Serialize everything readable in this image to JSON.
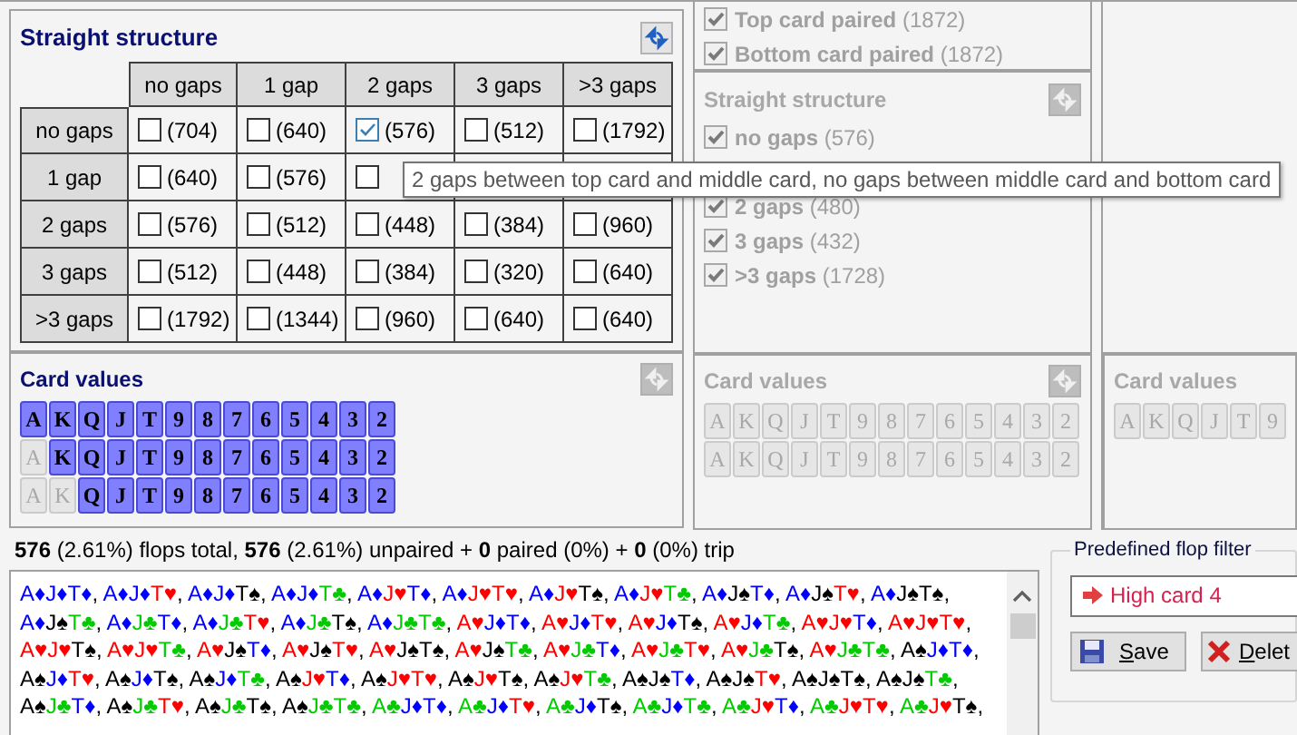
{
  "left_panel": {
    "straight_structure": {
      "title": "Straight structure",
      "columns": [
        "no gaps",
        "1 gap",
        "2 gaps",
        "3 gaps",
        ">3 gaps"
      ],
      "rows": [
        {
          "label": "no gaps",
          "cells": [
            {
              "count": "(704)",
              "checked": false
            },
            {
              "count": "(640)",
              "checked": false
            },
            {
              "count": "(576)",
              "checked": true
            },
            {
              "count": "(512)",
              "checked": false
            },
            {
              "count": "(1792)",
              "checked": false
            }
          ]
        },
        {
          "label": "1 gap",
          "cells": [
            {
              "count": "(640)",
              "checked": false
            },
            {
              "count": "(576)",
              "checked": false
            },
            {
              "checked": false
            },
            null,
            null
          ]
        },
        {
          "label": "2 gaps",
          "cells": [
            {
              "count": "(576)",
              "checked": false
            },
            {
              "count": "(512)",
              "checked": false
            },
            {
              "count": "(448)",
              "checked": false
            },
            {
              "count": "(384)",
              "checked": false
            },
            {
              "count": "(960)",
              "checked": false
            }
          ]
        },
        {
          "label": "3 gaps",
          "cells": [
            {
              "count": "(512)",
              "checked": false
            },
            {
              "count": "(448)",
              "checked": false
            },
            {
              "count": "(384)",
              "checked": false
            },
            {
              "count": "(320)",
              "checked": false
            },
            {
              "count": "(640)",
              "checked": false
            }
          ]
        },
        {
          "label": ">3 gaps",
          "cells": [
            {
              "count": "(1792)",
              "checked": false
            },
            {
              "count": "(1344)",
              "checked": false
            },
            {
              "count": "(960)",
              "checked": false
            },
            {
              "count": "(640)",
              "checked": false
            },
            {
              "count": "(640)",
              "checked": false
            }
          ]
        }
      ]
    },
    "card_values": {
      "title": "Card values",
      "rows": [
        {
          "cards": [
            {
              "rank": "A",
              "selected": true
            },
            {
              "rank": "K",
              "selected": true
            },
            {
              "rank": "Q",
              "selected": true
            },
            {
              "rank": "J",
              "selected": true
            },
            {
              "rank": "T",
              "selected": true
            },
            {
              "rank": "9",
              "selected": true
            },
            {
              "rank": "8",
              "selected": true
            },
            {
              "rank": "7",
              "selected": true
            },
            {
              "rank": "6",
              "selected": true
            },
            {
              "rank": "5",
              "selected": true
            },
            {
              "rank": "4",
              "selected": true
            },
            {
              "rank": "3",
              "selected": true
            },
            {
              "rank": "2",
              "selected": true
            }
          ]
        },
        {
          "cards": [
            {
              "rank": "A",
              "selected": false
            },
            {
              "rank": "K",
              "selected": true
            },
            {
              "rank": "Q",
              "selected": true
            },
            {
              "rank": "J",
              "selected": true
            },
            {
              "rank": "T",
              "selected": true
            },
            {
              "rank": "9",
              "selected": true
            },
            {
              "rank": "8",
              "selected": true
            },
            {
              "rank": "7",
              "selected": true
            },
            {
              "rank": "6",
              "selected": true
            },
            {
              "rank": "5",
              "selected": true
            },
            {
              "rank": "4",
              "selected": true
            },
            {
              "rank": "3",
              "selected": true
            },
            {
              "rank": "2",
              "selected": true
            }
          ]
        },
        {
          "cards": [
            {
              "rank": "A",
              "selected": false
            },
            {
              "rank": "K",
              "selected": false
            },
            {
              "rank": "Q",
              "selected": true
            },
            {
              "rank": "J",
              "selected": true
            },
            {
              "rank": "T",
              "selected": true
            },
            {
              "rank": "9",
              "selected": true
            },
            {
              "rank": "8",
              "selected": true
            },
            {
              "rank": "7",
              "selected": true
            },
            {
              "rank": "6",
              "selected": true
            },
            {
              "rank": "5",
              "selected": true
            },
            {
              "rank": "4",
              "selected": true
            },
            {
              "rank": "3",
              "selected": true
            },
            {
              "rank": "2",
              "selected": true
            }
          ]
        }
      ]
    }
  },
  "middle_panel": {
    "disabled": true,
    "paired": [
      {
        "label": "Top card paired",
        "count": "(1872)",
        "checked": true
      },
      {
        "label": "Bottom card paired",
        "count": "(1872)",
        "checked": true
      }
    ],
    "straight_structure": {
      "title": "Straight structure",
      "items": [
        {
          "kind": "checkbox",
          "label": "no gaps",
          "count": "(576)",
          "checked": true
        },
        {
          "kind": "covered"
        },
        {
          "kind": "checkbox",
          "label": "2 gaps",
          "count": "(480)",
          "checked": true
        },
        {
          "kind": "checkbox",
          "label": "3 gaps",
          "count": "(432)",
          "checked": true
        },
        {
          "kind": "checkbox",
          "label": ">3 gaps",
          "count": "(1728)",
          "checked": true
        }
      ]
    },
    "card_values": {
      "title": "Card values",
      "rows": [
        {
          "cards": [
            {
              "rank": "A",
              "selected": false
            },
            {
              "rank": "K",
              "selected": false
            },
            {
              "rank": "Q",
              "selected": false
            },
            {
              "rank": "J",
              "selected": false
            },
            {
              "rank": "T",
              "selected": false
            },
            {
              "rank": "9",
              "selected": false
            },
            {
              "rank": "8",
              "selected": false
            },
            {
              "rank": "7",
              "selected": false
            },
            {
              "rank": "6",
              "selected": false
            },
            {
              "rank": "5",
              "selected": false
            },
            {
              "rank": "4",
              "selected": false
            },
            {
              "rank": "3",
              "selected": false
            },
            {
              "rank": "2",
              "selected": false
            }
          ]
        },
        {
          "cards": [
            {
              "rank": "A",
              "selected": false
            },
            {
              "rank": "K",
              "selected": false
            },
            {
              "rank": "Q",
              "selected": false
            },
            {
              "rank": "J",
              "selected": false
            },
            {
              "rank": "T",
              "selected": false
            },
            {
              "rank": "9",
              "selected": false
            },
            {
              "rank": "8",
              "selected": false
            },
            {
              "rank": "7",
              "selected": false
            },
            {
              "rank": "6",
              "selected": false
            },
            {
              "rank": "5",
              "selected": false
            },
            {
              "rank": "4",
              "selected": false
            },
            {
              "rank": "3",
              "selected": false
            },
            {
              "rank": "2",
              "selected": false
            }
          ]
        }
      ]
    }
  },
  "right_panel": {
    "card_values": {
      "title": "Card values",
      "rows": [
        {
          "cards": [
            {
              "rank": "A",
              "selected": false
            },
            {
              "rank": "K",
              "selected": false
            },
            {
              "rank": "Q",
              "selected": false
            },
            {
              "rank": "J",
              "selected": false
            },
            {
              "rank": "T",
              "selected": false
            },
            {
              "rank": "9",
              "selected": false
            }
          ]
        }
      ]
    }
  },
  "tooltip": "2 gaps between top card and middle card, no gaps between middle card and bottom card",
  "summary": "**576** (2.61%) flops total, **576** (2.61%) unpaired + **0** paired (0%) + **0** (0%) trip",
  "flops": [
    {
      "cards": [
        {
          "text": "A♦",
          "color": "#0000ff"
        },
        {
          "text": "J♦",
          "color": "#0000ff"
        },
        {
          "text": "T♦",
          "color": "#0000ff"
        }
      ],
      "suffix": ","
    },
    {
      "cards": [
        {
          "text": "A♦",
          "color": "#0000ff"
        },
        {
          "text": "J♦",
          "color": "#0000ff"
        },
        {
          "text": "T♥",
          "color": "#ff0000"
        }
      ],
      "suffix": ","
    },
    {
      "cards": [
        {
          "text": "A♦",
          "color": "#0000ff"
        },
        {
          "text": "J♦",
          "color": "#0000ff"
        },
        {
          "text": "T♠",
          "color": "#000000"
        }
      ],
      "suffix": ","
    },
    {
      "cards": [
        {
          "text": "A♦",
          "color": "#0000ff"
        },
        {
          "text": "J♦",
          "color": "#0000ff"
        },
        {
          "text": "T♣",
          "color": "#00cc00"
        }
      ],
      "suffix": ","
    },
    {
      "cards": [
        {
          "text": "A♦",
          "color": "#0000ff"
        },
        {
          "text": "J♥",
          "color": "#ff0000"
        },
        {
          "text": "T♦",
          "color": "#0000ff"
        }
      ],
      "suffix": ","
    },
    {
      "cards": [
        {
          "text": "A♦",
          "color": "#0000ff"
        },
        {
          "text": "J♥",
          "color": "#ff0000"
        },
        {
          "text": "T♥",
          "color": "#ff0000"
        }
      ],
      "suffix": ","
    },
    {
      "cards": [
        {
          "text": "A♦",
          "color": "#0000ff"
        },
        {
          "text": "J♥",
          "color": "#ff0000"
        },
        {
          "text": "T♠",
          "color": "#000000"
        }
      ],
      "suffix": ","
    },
    {
      "cards": [
        {
          "text": "A♦",
          "color": "#0000ff"
        },
        {
          "text": "J♥",
          "color": "#ff0000"
        },
        {
          "text": "T♣",
          "color": "#00cc00"
        }
      ],
      "suffix": ","
    },
    {
      "cards": [
        {
          "text": "A♦",
          "color": "#0000ff"
        },
        {
          "text": "J♠",
          "color": "#000000"
        },
        {
          "text": "T♦",
          "color": "#0000ff"
        }
      ],
      "suffix": ","
    },
    {
      "cards": [
        {
          "text": "A♦",
          "color": "#0000ff"
        },
        {
          "text": "J♠",
          "color": "#000000"
        },
        {
          "text": "T♥",
          "color": "#ff0000"
        }
      ],
      "suffix": ","
    },
    {
      "cards": [
        {
          "text": "A♦",
          "color": "#0000ff"
        },
        {
          "text": "J♠",
          "color": "#000000"
        },
        {
          "text": "T♠",
          "color": "#000000"
        }
      ],
      "suffix": ","
    },
    {
      "cards": [
        {
          "text": "A♦",
          "color": "#0000ff"
        },
        {
          "text": "J♠",
          "color": "#000000"
        },
        {
          "text": "T♣",
          "color": "#00cc00"
        }
      ],
      "suffix": ","
    },
    {
      "cards": [
        {
          "text": "A♦",
          "color": "#0000ff"
        },
        {
          "text": "J♣",
          "color": "#00cc00"
        },
        {
          "text": "T♦",
          "color": "#0000ff"
        }
      ],
      "suffix": ","
    },
    {
      "cards": [
        {
          "text": "A♦",
          "color": "#0000ff"
        },
        {
          "text": "J♣",
          "color": "#00cc00"
        },
        {
          "text": "T♥",
          "color": "#ff0000"
        }
      ],
      "suffix": ","
    },
    {
      "cards": [
        {
          "text": "A♦",
          "color": "#0000ff"
        },
        {
          "text": "J♣",
          "color": "#00cc00"
        },
        {
          "text": "T♠",
          "color": "#000000"
        }
      ],
      "suffix": ","
    },
    {
      "cards": [
        {
          "text": "A♦",
          "color": "#0000ff"
        },
        {
          "text": "J♣",
          "color": "#00cc00"
        },
        {
          "text": "T♣",
          "color": "#00cc00"
        }
      ],
      "suffix": ","
    },
    {
      "cards": [
        {
          "text": "A♥",
          "color": "#ff0000"
        },
        {
          "text": "J♦",
          "color": "#0000ff"
        },
        {
          "text": "T♦",
          "color": "#0000ff"
        }
      ],
      "suffix": ","
    },
    {
      "cards": [
        {
          "text": "A♥",
          "color": "#ff0000"
        },
        {
          "text": "J♦",
          "color": "#0000ff"
        },
        {
          "text": "T♥",
          "color": "#ff0000"
        }
      ],
      "suffix": ","
    },
    {
      "cards": [
        {
          "text": "A♥",
          "color": "#ff0000"
        },
        {
          "text": "J♦",
          "color": "#0000ff"
        },
        {
          "text": "T♠",
          "color": "#000000"
        }
      ],
      "suffix": ","
    },
    {
      "cards": [
        {
          "text": "A♥",
          "color": "#ff0000"
        },
        {
          "text": "J♦",
          "color": "#0000ff"
        },
        {
          "text": "T♣",
          "color": "#00cc00"
        }
      ],
      "suffix": ","
    },
    {
      "cards": [
        {
          "text": "A♥",
          "color": "#ff0000"
        },
        {
          "text": "J♥",
          "color": "#ff0000"
        },
        {
          "text": "T♦",
          "color": "#0000ff"
        }
      ],
      "suffix": ","
    },
    {
      "cards": [
        {
          "text": "A♥",
          "color": "#ff0000"
        },
        {
          "text": "J♥",
          "color": "#ff0000"
        },
        {
          "text": "T♥",
          "color": "#ff0000"
        }
      ],
      "suffix": ","
    },
    {
      "cards": [
        {
          "text": "A♥",
          "color": "#ff0000"
        },
        {
          "text": "J♥",
          "color": "#ff0000"
        },
        {
          "text": "T♠",
          "color": "#000000"
        }
      ],
      "suffix": ","
    },
    {
      "cards": [
        {
          "text": "A♥",
          "color": "#ff0000"
        },
        {
          "text": "J♥",
          "color": "#ff0000"
        },
        {
          "text": "T♣",
          "color": "#00cc00"
        }
      ],
      "suffix": ","
    },
    {
      "cards": [
        {
          "text": "A♥",
          "color": "#ff0000"
        },
        {
          "text": "J♠",
          "color": "#000000"
        },
        {
          "text": "T♦",
          "color": "#0000ff"
        }
      ],
      "suffix": ","
    },
    {
      "cards": [
        {
          "text": "A♥",
          "color": "#ff0000"
        },
        {
          "text": "J♠",
          "color": "#000000"
        },
        {
          "text": "T♥",
          "color": "#ff0000"
        }
      ],
      "suffix": ","
    },
    {
      "cards": [
        {
          "text": "A♥",
          "color": "#ff0000"
        },
        {
          "text": "J♠",
          "color": "#000000"
        },
        {
          "text": "T♠",
          "color": "#000000"
        }
      ],
      "suffix": ","
    },
    {
      "cards": [
        {
          "text": "A♥",
          "color": "#ff0000"
        },
        {
          "text": "J♠",
          "color": "#000000"
        },
        {
          "text": "T♣",
          "color": "#00cc00"
        }
      ],
      "suffix": ","
    },
    {
      "cards": [
        {
          "text": "A♥",
          "color": "#ff0000"
        },
        {
          "text": "J♣",
          "color": "#00cc00"
        },
        {
          "text": "T♦",
          "color": "#0000ff"
        }
      ],
      "suffix": ","
    },
    {
      "cards": [
        {
          "text": "A♥",
          "color": "#ff0000"
        },
        {
          "text": "J♣",
          "color": "#00cc00"
        },
        {
          "text": "T♥",
          "color": "#ff0000"
        }
      ],
      "suffix": ","
    },
    {
      "cards": [
        {
          "text": "A♥",
          "color": "#ff0000"
        },
        {
          "text": "J♣",
          "color": "#00cc00"
        },
        {
          "text": "T♠",
          "color": "#000000"
        }
      ],
      "suffix": ","
    },
    {
      "cards": [
        {
          "text": "A♥",
          "color": "#ff0000"
        },
        {
          "text": "J♣",
          "color": "#00cc00"
        },
        {
          "text": "T♣",
          "color": "#00cc00"
        }
      ],
      "suffix": ","
    },
    {
      "cards": [
        {
          "text": "A♠",
          "color": "#000000"
        },
        {
          "text": "J♦",
          "color": "#0000ff"
        },
        {
          "text": "T♦",
          "color": "#0000ff"
        }
      ],
      "suffix": ","
    },
    {
      "cards": [
        {
          "text": "A♠",
          "color": "#000000"
        },
        {
          "text": "J♦",
          "color": "#0000ff"
        },
        {
          "text": "T♥",
          "color": "#ff0000"
        }
      ],
      "suffix": ","
    },
    {
      "cards": [
        {
          "text": "A♠",
          "color": "#000000"
        },
        {
          "text": "J♦",
          "color": "#0000ff"
        },
        {
          "text": "T♠",
          "color": "#000000"
        }
      ],
      "suffix": ","
    },
    {
      "cards": [
        {
          "text": "A♠",
          "color": "#000000"
        },
        {
          "text": "J♦",
          "color": "#0000ff"
        },
        {
          "text": "T♣",
          "color": "#00cc00"
        }
      ],
      "suffix": ","
    },
    {
      "cards": [
        {
          "text": "A♠",
          "color": "#000000"
        },
        {
          "text": "J♥",
          "color": "#ff0000"
        },
        {
          "text": "T♦",
          "color": "#0000ff"
        }
      ],
      "suffix": ","
    },
    {
      "cards": [
        {
          "text": "A♠",
          "color": "#000000"
        },
        {
          "text": "J♥",
          "color": "#ff0000"
        },
        {
          "text": "T♥",
          "color": "#ff0000"
        }
      ],
      "suffix": ","
    },
    {
      "cards": [
        {
          "text": "A♠",
          "color": "#000000"
        },
        {
          "text": "J♥",
          "color": "#ff0000"
        },
        {
          "text": "T♠",
          "color": "#000000"
        }
      ],
      "suffix": ","
    },
    {
      "cards": [
        {
          "text": "A♠",
          "color": "#000000"
        },
        {
          "text": "J♥",
          "color": "#ff0000"
        },
        {
          "text": "T♣",
          "color": "#00cc00"
        }
      ],
      "suffix": ","
    },
    {
      "cards": [
        {
          "text": "A♠",
          "color": "#000000"
        },
        {
          "text": "J♠",
          "color": "#000000"
        },
        {
          "text": "T♦",
          "color": "#0000ff"
        }
      ],
      "suffix": ","
    },
    {
      "cards": [
        {
          "text": "A♠",
          "color": "#000000"
        },
        {
          "text": "J♠",
          "color": "#000000"
        },
        {
          "text": "T♥",
          "color": "#ff0000"
        }
      ],
      "suffix": ","
    },
    {
      "cards": [
        {
          "text": "A♠",
          "color": "#000000"
        },
        {
          "text": "J♠",
          "color": "#000000"
        },
        {
          "text": "T♠",
          "color": "#000000"
        }
      ],
      "suffix": ","
    },
    {
      "cards": [
        {
          "text": "A♠",
          "color": "#000000"
        },
        {
          "text": "J♠",
          "color": "#000000"
        },
        {
          "text": "T♣",
          "color": "#00cc00"
        }
      ],
      "suffix": ","
    },
    {
      "cards": [
        {
          "text": "A♠",
          "color": "#000000"
        },
        {
          "text": "J♣",
          "color": "#00cc00"
        },
        {
          "text": "T♦",
          "color": "#0000ff"
        }
      ],
      "suffix": ","
    },
    {
      "cards": [
        {
          "text": "A♠",
          "color": "#000000"
        },
        {
          "text": "J♣",
          "color": "#00cc00"
        },
        {
          "text": "T♥",
          "color": "#ff0000"
        }
      ],
      "suffix": ","
    },
    {
      "cards": [
        {
          "text": "A♠",
          "color": "#000000"
        },
        {
          "text": "J♣",
          "color": "#00cc00"
        },
        {
          "text": "T♠",
          "color": "#000000"
        }
      ],
      "suffix": ","
    },
    {
      "cards": [
        {
          "text": "A♠",
          "color": "#000000"
        },
        {
          "text": "J♣",
          "color": "#00cc00"
        },
        {
          "text": "T♣",
          "color": "#00cc00"
        }
      ],
      "suffix": ","
    },
    {
      "cards": [
        {
          "text": "A♣",
          "color": "#00cc00"
        },
        {
          "text": "J♦",
          "color": "#0000ff"
        },
        {
          "text": "T♦",
          "color": "#0000ff"
        }
      ],
      "suffix": ","
    },
    {
      "cards": [
        {
          "text": "A♣",
          "color": "#00cc00"
        },
        {
          "text": "J♦",
          "color": "#0000ff"
        },
        {
          "text": "T♥",
          "color": "#ff0000"
        }
      ],
      "suffix": ","
    },
    {
      "cards": [
        {
          "text": "A♣",
          "color": "#00cc00"
        },
        {
          "text": "J♦",
          "color": "#0000ff"
        },
        {
          "text": "T♠",
          "color": "#000000"
        }
      ],
      "suffix": ","
    },
    {
      "cards": [
        {
          "text": "A♣",
          "color": "#00cc00"
        },
        {
          "text": "J♦",
          "color": "#0000ff"
        },
        {
          "text": "T♣",
          "color": "#00cc00"
        }
      ],
      "suffix": ","
    },
    {
      "cards": [
        {
          "text": "A♣",
          "color": "#00cc00"
        },
        {
          "text": "J♥",
          "color": "#ff0000"
        },
        {
          "text": "T♦",
          "color": "#0000ff"
        }
      ],
      "suffix": ","
    },
    {
      "cards": [
        {
          "text": "A♣",
          "color": "#00cc00"
        },
        {
          "text": "J♥",
          "color": "#ff0000"
        },
        {
          "text": "T♥",
          "color": "#ff0000"
        }
      ],
      "suffix": ","
    },
    {
      "cards": [
        {
          "text": "A♣",
          "color": "#00cc00"
        },
        {
          "text": "J♥",
          "color": "#ff0000"
        },
        {
          "text": "T♠",
          "color": "#000000"
        }
      ],
      "suffix": ","
    }
  ],
  "predefined_filter": {
    "title": "Predefined flop filter",
    "value": "High card 4",
    "buttons": [
      {
        "label": "Save",
        "kind": "save"
      },
      {
        "label": "Delet",
        "kind": "delete"
      }
    ]
  }
}
